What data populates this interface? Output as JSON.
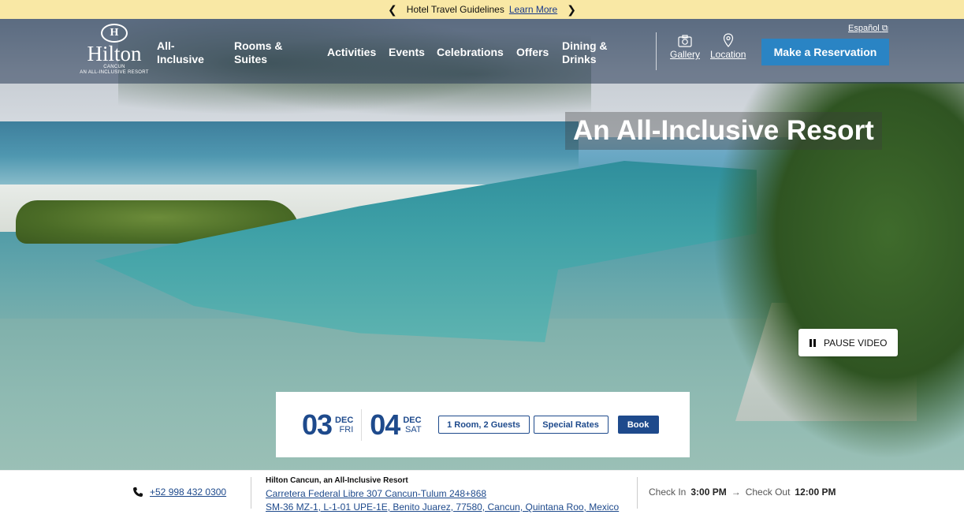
{
  "announcement": {
    "text": "Hotel Travel Guidelines",
    "link": "Learn More",
    "prev_icon": "chevron-left-icon",
    "next_icon": "chevron-right-icon"
  },
  "brand": {
    "logo_mark": "H",
    "name": "Hilton",
    "location": "CANCUN",
    "tagline": "AN ALL-INCLUSIVE RESORT"
  },
  "nav": {
    "items": [
      {
        "label_line1": "All-",
        "label_line2": "Inclusive"
      },
      {
        "label_line1": "Rooms &",
        "label_line2": "Suites"
      },
      {
        "label_line1": "Activities",
        "label_line2": ""
      },
      {
        "label_line1": "Events",
        "label_line2": ""
      },
      {
        "label_line1": "Celebrations",
        "label_line2": ""
      },
      {
        "label_line1": "Offers",
        "label_line2": ""
      },
      {
        "label_line1": "Dining &",
        "label_line2": "Drinks"
      }
    ],
    "gallery": "Gallery",
    "location": "Location",
    "reserve": "Make a Reservation",
    "language": "Español"
  },
  "hero": {
    "headline": "An All-Inclusive Resort",
    "pause": "PAUSE VIDEO"
  },
  "booking": {
    "checkin": {
      "day": "03",
      "month": "DEC",
      "weekday": "FRI"
    },
    "checkout": {
      "day": "04",
      "month": "DEC",
      "weekday": "SAT"
    },
    "rooms": "1 Room, 2 Guests",
    "rates": "Special Rates",
    "book": "Book",
    "accent": "#1e4a8c"
  },
  "footer": {
    "phone": "+52 998 432 0300",
    "hotel_name": "Hilton Cancun, an All-Inclusive Resort",
    "address1": "Carretera Federal Libre 307 Cancun-Tulum 248+868",
    "address2": "SM-36 MZ-1, L-1-01 UPE-1E, Benito Juarez, 77580, Cancun, Quintana Roo, Mexico",
    "checkin_label": "Check In",
    "checkin_time": "3:00 PM",
    "arrow": "→",
    "checkout_label": "Check Out",
    "checkout_time": "12:00 PM"
  }
}
